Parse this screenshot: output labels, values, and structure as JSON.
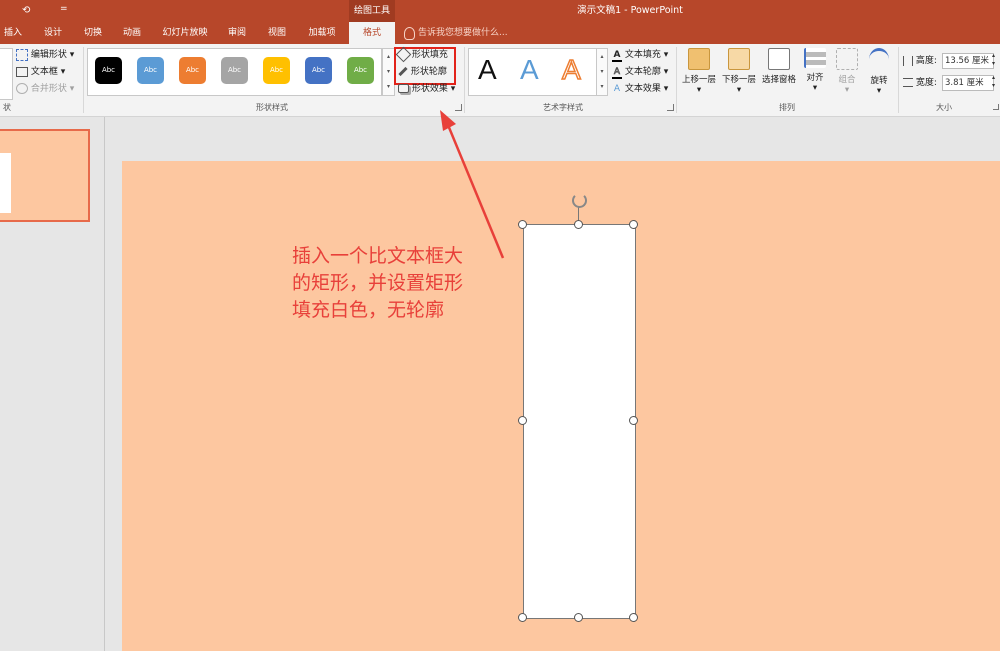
{
  "window": {
    "title": "演示文稿1 - PowerPoint",
    "contextual_tab_group": "绘图工具",
    "quick_access_dropdown": "="
  },
  "tabs": [
    {
      "label": "插入"
    },
    {
      "label": "设计"
    },
    {
      "label": "切换"
    },
    {
      "label": "动画"
    },
    {
      "label": "幻灯片放映"
    },
    {
      "label": "审阅"
    },
    {
      "label": "视图"
    },
    {
      "label": "加载项"
    },
    {
      "label": "格式"
    }
  ],
  "tell_me": "告诉我您想要做什么...",
  "ribbon": {
    "insert_shapes": {
      "edit_shape": "编辑形状",
      "text_box": "文本框",
      "merge_shapes": "合并形状",
      "group_label_partial": "状"
    },
    "shape_styles": {
      "swatch_text": "Abc",
      "swatches": [
        "#000000",
        "#5b9bd5",
        "#ed7d31",
        "#a5a5a5",
        "#ffc000",
        "#4472c4",
        "#70ad47"
      ],
      "shape_fill": "形状填充",
      "shape_outline": "形状轮廓",
      "shape_effects": "形状效果",
      "group_label": "形状样式"
    },
    "wordart": {
      "letter": "A",
      "text_fill": "文本填充",
      "text_outline": "文本轮廓",
      "text_effects": "文本效果",
      "group_label": "艺术字样式"
    },
    "arrange": {
      "bring_forward": "上移一层",
      "send_backward": "下移一层",
      "selection_pane": "选择窗格",
      "align": "对齐",
      "group": "组合",
      "rotate": "旋转",
      "group_label": "排列"
    },
    "size": {
      "height_label": "高度:",
      "height_value": "13.56 厘米",
      "width_label": "宽度:",
      "width_value": "3.81 厘米",
      "group_label": "大小"
    }
  },
  "annotation": {
    "lines": [
      "插入一个比文本框大",
      "的矩形，并设置矩形",
      "填充白色，无轮廓"
    ],
    "color": "#e8403a"
  },
  "colors": {
    "accent": "#b7472a",
    "slide_bg": "#fdc7a0",
    "highlight_box": "#e2231a"
  }
}
